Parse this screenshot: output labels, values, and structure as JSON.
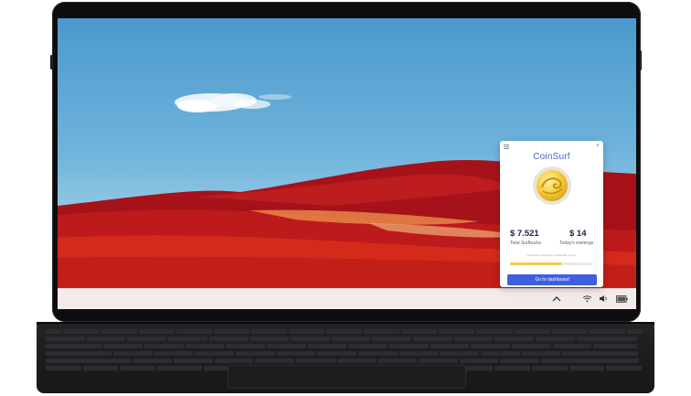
{
  "coinsurf": {
    "title": "CoinSurf",
    "menu_icon": "hamburger-menu-icon",
    "close_icon": "×",
    "coin_icon": "coin-logo-icon",
    "total_surfbucks_value": "$ 7.521",
    "total_surfbucks_label": "Total Surfbucks",
    "todays_earnings_value": "$ 14",
    "todays_earnings_label": "Today's earnings",
    "progress_label": "Everyone's progress contributed to pool",
    "progress_fraction": 0.62,
    "button_label": "Go to dashboard",
    "colors": {
      "brand": "#4b63c9",
      "button": "#3f5fe0",
      "progress": "#f2c94c"
    }
  },
  "taskbar": {
    "icons": [
      "chevron-up-icon",
      "wifi-icon",
      "volume-icon",
      "battery-icon"
    ],
    "background": "#f3eaea"
  }
}
